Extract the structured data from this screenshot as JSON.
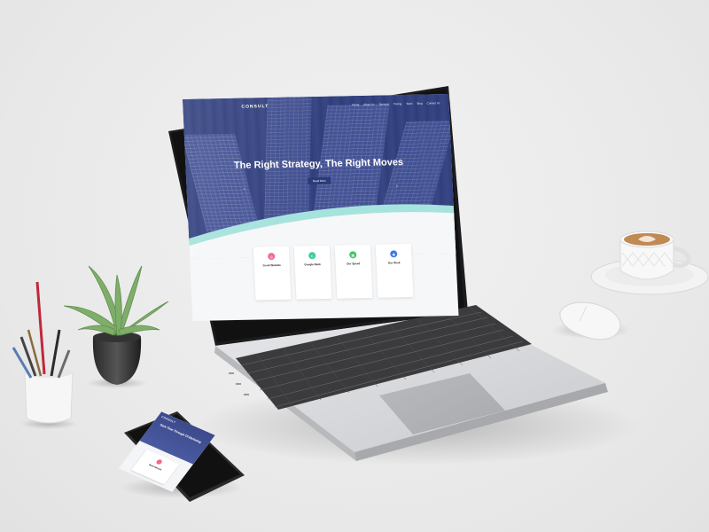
{
  "site": {
    "brand": "CONSULT",
    "nav": [
      "Home",
      "About Us",
      "Services",
      "Pricing",
      "Team",
      "Blog",
      "Contact Us"
    ],
    "hero": {
      "title": "The Right Strategy, The Right Moves",
      "subtitle": "",
      "cta": "Read More",
      "prev_arrow": "‹",
      "next_arrow": "›"
    },
    "features": [
      {
        "icon": "target-icon",
        "glyph": "◎",
        "color": "#f06a8a",
        "title": "Good Website",
        "text": ""
      },
      {
        "icon": "google-icon",
        "glyph": "G",
        "color": "#3ec79b",
        "title": "Google Rank",
        "text": ""
      },
      {
        "icon": "speed-icon",
        "glyph": "▣",
        "color": "#41c46d",
        "title": "Our Speed",
        "text": ""
      },
      {
        "icon": "web-icon",
        "glyph": "◉",
        "color": "#3d7be0",
        "title": "Our Work",
        "text": ""
      }
    ]
  },
  "phone": {
    "brand": "CONSULT",
    "hero_title": "Save Time Through Of Marketing",
    "card_title": "Good Website",
    "card_icon_color": "#f06a8a"
  },
  "colors": {
    "hero_blue": "#3e4c8c",
    "wave_teal": "#a6e3dc",
    "button_navy": "#2c3a78"
  }
}
